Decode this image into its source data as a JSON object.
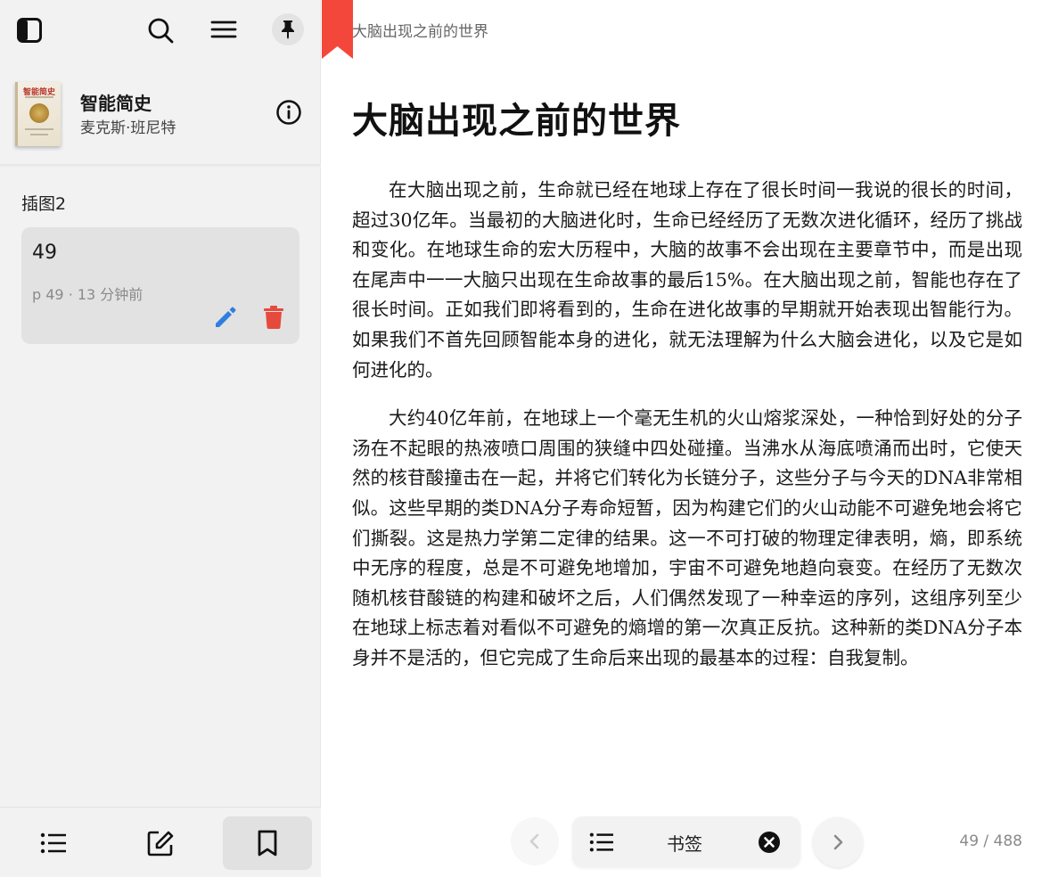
{
  "sidebar": {
    "book": {
      "title": "智能简史",
      "author": "麦克斯·班尼特",
      "cover_text": "智能简史"
    },
    "section_label": "插图2",
    "bookmark": {
      "title": "49",
      "meta": "p 49 · 13 分钟前"
    }
  },
  "reader": {
    "running_head": "大脑出现之前的世界",
    "chapter_title": "大脑出现之前的世界",
    "paragraphs": [
      "在大脑出现之前，生命就已经在地球上存在了很长时间一我说的很长的时间，超过30亿年。当最初的大脑进化时，生命已经经历了无数次进化循环，经历了挑战和变化。在地球生命的宏大历程中，大脑的故事不会出现在主要章节中，而是出现在尾声中一一大脑只出现在生命故事的最后15%。在大脑出现之前，智能也存在了很长时间。正如我们即将看到的，生命在进化故事的早期就开始表现出智能行为。如果我们不首先回顾智能本身的进化，就无法理解为什么大脑会进化，以及它是如何进化的。",
      "大约40亿年前，在地球上一个毫无生机的火山熔浆深处，一种恰到好处的分子汤在不起眼的热液喷口周围的狭缝中四处碰撞。当沸水从海底喷涌而出时，它使天然的核苷酸撞击在一起，并将它们转化为长链分子，这些分子与今天的DNA非常相似。这些早期的类DNA分子寿命短暂，因为构建它们的火山动能不可避免地会将它们撕裂。这是热力学第二定律的结果。这一不可打破的物理定律表明，熵，即系统中无序的程度，总是不可避免地增加，宇宙不可避免地趋向衰变。在经历了无数次随机核苷酸链的构建和破坏之后，人们偶然发现了一种幸运的序列，这组序列至少在地球上标志着对看似不可避免的熵增的第一次真正反抗。这种新的类DNA分子本身并不是活的，但它完成了生命后来出现的最基本的过程：自我复制。"
    ],
    "nav": {
      "pill_label": "书签",
      "page_counter": "49 / 488"
    }
  },
  "colors": {
    "accent_red": "#f4473b",
    "edit_blue": "#2f7fe0",
    "delete_red": "#e64a3d"
  }
}
